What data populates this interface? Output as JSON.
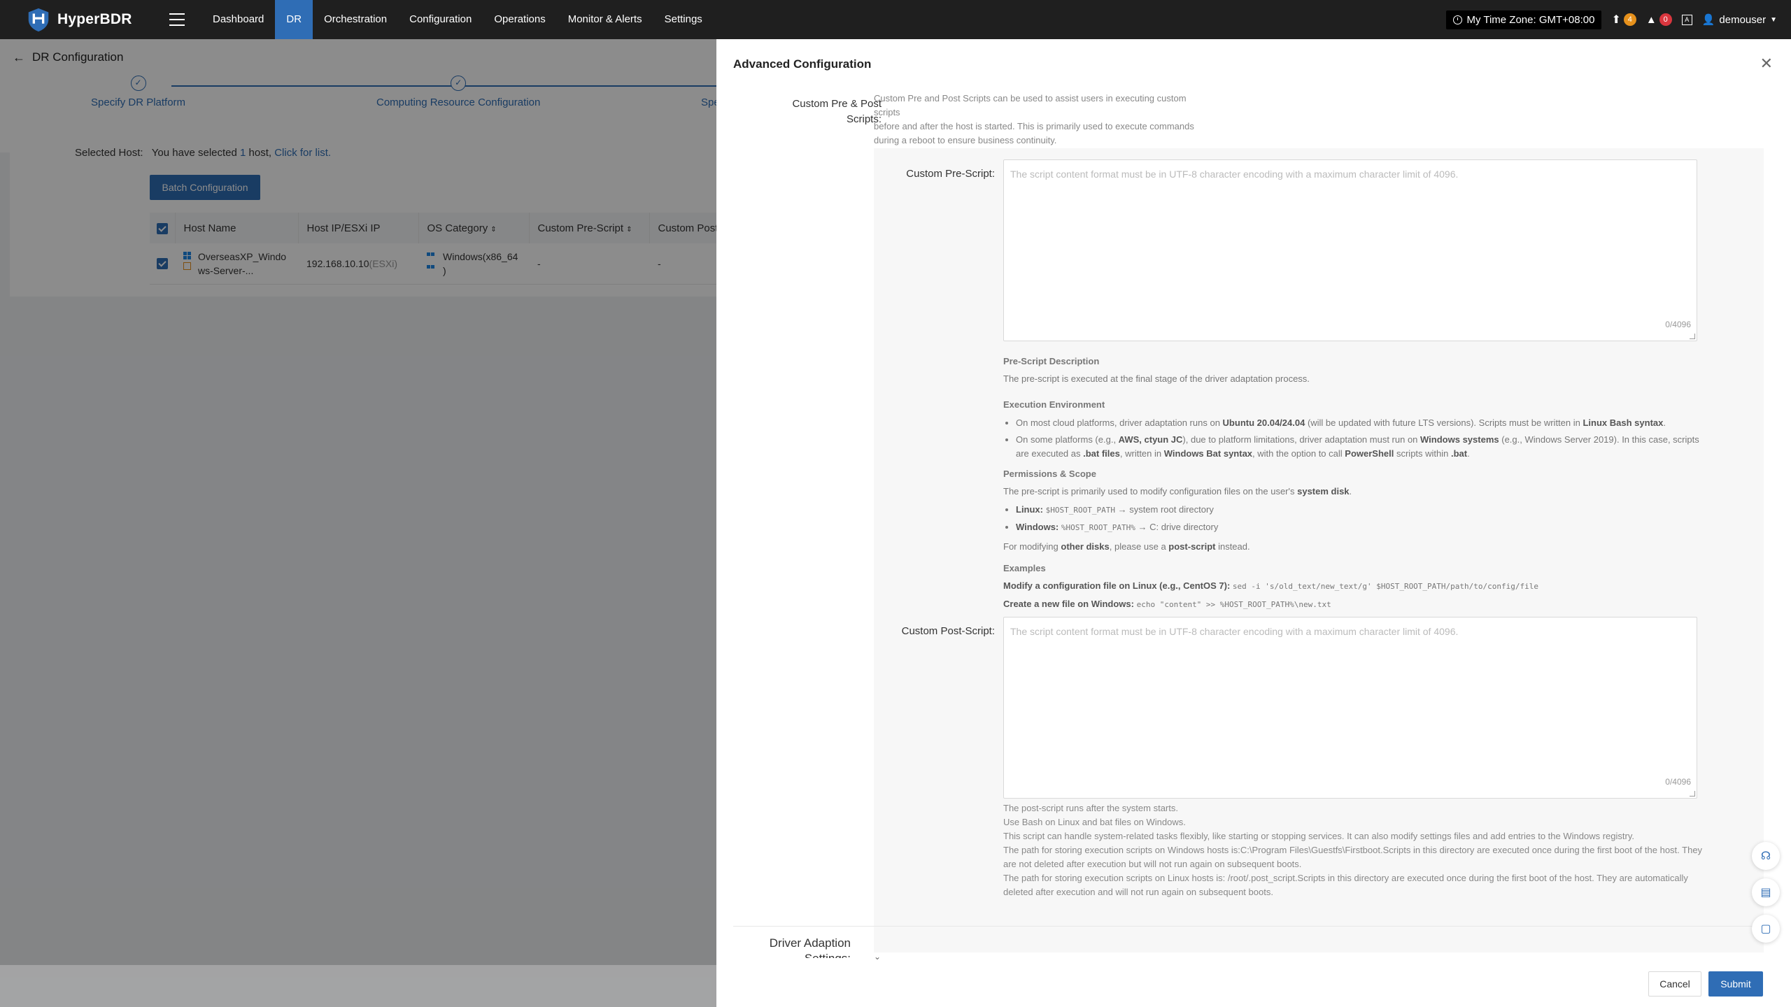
{
  "app": {
    "name": "HyperBDR"
  },
  "nav": {
    "items": [
      {
        "label": "Dashboard"
      },
      {
        "label": "DR",
        "active": true
      },
      {
        "label": "Orchestration"
      },
      {
        "label": "Configuration"
      },
      {
        "label": "Operations"
      },
      {
        "label": "Monitor & Alerts"
      },
      {
        "label": "Settings"
      }
    ]
  },
  "topbar": {
    "timezone": "My Time Zone: GMT+08:00",
    "upload_count": "4",
    "alert_count": "0",
    "user": "demouser"
  },
  "page": {
    "title": "DR Configuration",
    "steps": [
      {
        "label": "Specify DR Platform"
      },
      {
        "label": "Computing Resource Configuration"
      },
      {
        "label": "Spe"
      }
    ],
    "selected_host_label": "Selected Host:",
    "selected_host_text": "You have selected ",
    "selected_host_count": "1",
    "selected_host_suffix": " host, ",
    "click_for_list": "Click for list.",
    "batch_button": "Batch Configuration",
    "table": {
      "headers": [
        "Host Name",
        "Host IP/ESXi IP",
        "OS Category",
        "Custom Pre-Script",
        "Custom Post"
      ],
      "rows": [
        {
          "host_name_1": "OverseasXP_Windo",
          "host_name_2": "ws-Server-...",
          "ip": "192.168.10.10",
          "ip_suffix": "(ESXi)",
          "os_1": "Windows(x86_64",
          "os_2": ")",
          "pre": "-",
          "post": "-"
        }
      ]
    }
  },
  "drawer": {
    "title": "Advanced Configuration",
    "scripts_label_1": "Custom Pre & Post",
    "scripts_label_2": "Scripts:",
    "intro_1": "Custom Pre and Post Scripts can be used to assist users in executing custom scripts",
    "intro_2": "before and after the host is started. This is primarily used to execute commands",
    "intro_3": "during a reboot to ensure business continuity.",
    "pre_label": "Custom Pre-Script:",
    "pre_placeholder": "The script content format must be in UTF-8 character encoding with a maximum character limit of 4096.",
    "pre_count": "0/4096",
    "pre_desc": {
      "h_desc": "Pre-Script Description",
      "desc": "The pre-script is executed at the final stage of the driver adaptation process.",
      "h_env": "Execution Environment",
      "env_1a": "On most cloud platforms, driver adaptation runs on ",
      "env_1b": "Ubuntu 20.04/24.04",
      "env_1c": " (will be updated with future LTS versions). Scripts must be written in ",
      "env_1d": "Linux Bash syntax",
      "env_1e": ".",
      "env_2a": "On some platforms (e.g., ",
      "env_2b": "AWS, ctyun JC",
      "env_2c": "), due to platform limitations, driver adaptation must run on ",
      "env_2d": "Windows systems",
      "env_2e": " (e.g., Windows Server 2019). In this case, scripts are executed as ",
      "env_2f": ".bat files",
      "env_2g": ", written in ",
      "env_2h": "Windows Bat syntax",
      "env_2i": ", with the option to call ",
      "env_2j": "PowerShell",
      "env_2k": " scripts within ",
      "env_2l": ".bat",
      "env_2m": ".",
      "h_perm": "Permissions & Scope",
      "perm_a": "The pre-script is primarily used to modify configuration files on the user's ",
      "perm_b": "system disk",
      "perm_c": ".",
      "linux_label": "Linux:",
      "linux_var": "$HOST_ROOT_PATH",
      "linux_desc": " → system root directory",
      "win_label": "Windows:",
      "win_var": "%HOST_ROOT_PATH%",
      "win_desc": " → C: drive directory",
      "other_a": "For modifying ",
      "other_b": "other disks",
      "other_c": ", please use a ",
      "other_d": "post-script",
      "other_e": " instead.",
      "h_examples": "Examples",
      "ex1_label": "Modify a configuration file on Linux (e.g., CentOS 7):",
      "ex1_code": "sed -i 's/old_text/new_text/g' $HOST_ROOT_PATH/path/to/config/file",
      "ex2_label": "Create a new file on Windows:",
      "ex2_code": "echo \"content\" >> %HOST_ROOT_PATH%\\new.txt"
    },
    "post_label": "Custom Post-Script:",
    "post_placeholder": "The script content format must be in UTF-8 character encoding with a maximum character limit of 4096.",
    "post_count": "0/4096",
    "post_desc": [
      "The post-script runs after the system starts.",
      "Use Bash on Linux and bat files on Windows.",
      "This script can handle system-related tasks flexibly, like starting or stopping services. It can also modify settings files and add entries to the Windows registry.",
      "The path for storing execution scripts on Windows hosts is:C:\\Program Files\\Guestfs\\Firstboot.Scripts in this directory are executed once during the first boot of the host. They are not deleted after execution but will not run again on subsequent boots.",
      "The path for storing execution scripts on Linux hosts is: /root/.post_script.Scripts in this directory are executed once during the first boot of the host. They are automatically deleted after execution and will not run again on subsequent boots."
    ],
    "driver_label": "Driver Adaption Settings:",
    "cancel": "Cancel",
    "submit": "Submit"
  },
  "colors": {
    "primary": "#2f6db5",
    "topbar": "#1f1f1f"
  }
}
